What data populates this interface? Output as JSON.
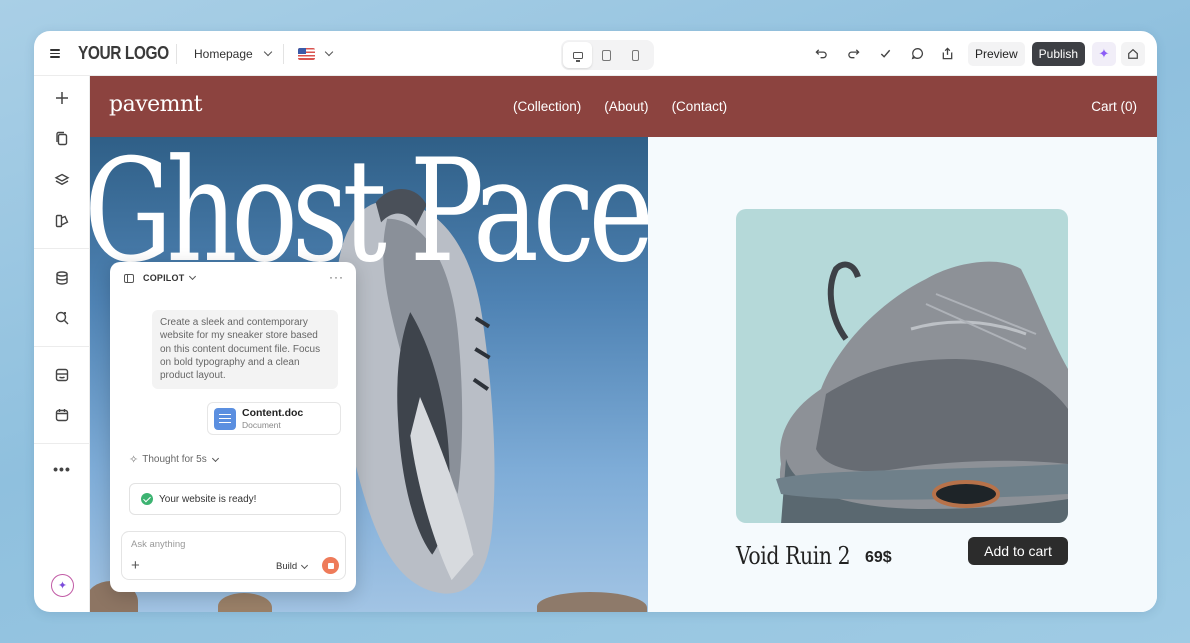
{
  "header": {
    "logo": "YOUR LOGO",
    "page_select": "Homepage",
    "preview_label": "Preview",
    "publish_label": "Publish"
  },
  "site": {
    "brand": "pavemnt",
    "nav": [
      "(Collection)",
      "(About)",
      "(Contact)"
    ],
    "cart": "Cart (0)",
    "hero_title": "Ghost Pace",
    "product": {
      "name": "Void Ruin 2",
      "price": "69$",
      "cta": "Add to cart"
    }
  },
  "copilot": {
    "title": "COPILOT",
    "more": "···",
    "prompt": "Create a sleek and contemporary website for my sneaker store based on this content document file. Focus on bold typography and a clean product layout.",
    "file": {
      "name": "Content.doc",
      "type": "Document"
    },
    "thought": "Thought for 5s",
    "status": "Your website is ready!",
    "input_placeholder": "Ask anything",
    "mode": "Build"
  },
  "colors": {
    "nav_bg": "#8c433f",
    "publish_bg": "#3d3f44",
    "product_bg": "#b5d9d9",
    "stop_button": "#ee7b5a",
    "ready_check": "#3cb371"
  }
}
